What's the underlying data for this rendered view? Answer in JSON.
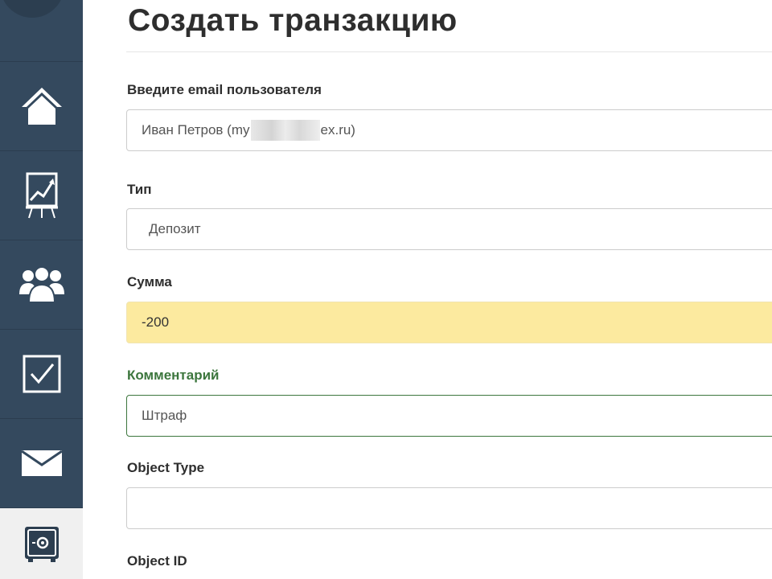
{
  "sidebar": {
    "items": [
      {
        "name": "home",
        "icon": "home-icon"
      },
      {
        "name": "analytics",
        "icon": "chart-board-icon"
      },
      {
        "name": "users",
        "icon": "users-group-icon"
      },
      {
        "name": "tasks",
        "icon": "checkbox-icon"
      },
      {
        "name": "messages",
        "icon": "envelope-icon"
      },
      {
        "name": "finance",
        "icon": "safe-icon",
        "active": true
      }
    ]
  },
  "page": {
    "title": "Создать транзакцию"
  },
  "form": {
    "user": {
      "label": "Введите email пользователя",
      "value_prefix": "Иван Петров (my",
      "value_suffix": "ex.ru)"
    },
    "type": {
      "label": "Тип",
      "value": "Депозит"
    },
    "amount": {
      "label": "Сумма",
      "value": "-200"
    },
    "comment": {
      "label": "Комментарий",
      "value": "Штраф"
    },
    "object_type": {
      "label": "Object Type",
      "value": ""
    },
    "object_id": {
      "label": "Object ID"
    }
  },
  "colors": {
    "sidebar": "#34495e",
    "warning_fill": "#fcea9f",
    "success": "#3c763d"
  }
}
